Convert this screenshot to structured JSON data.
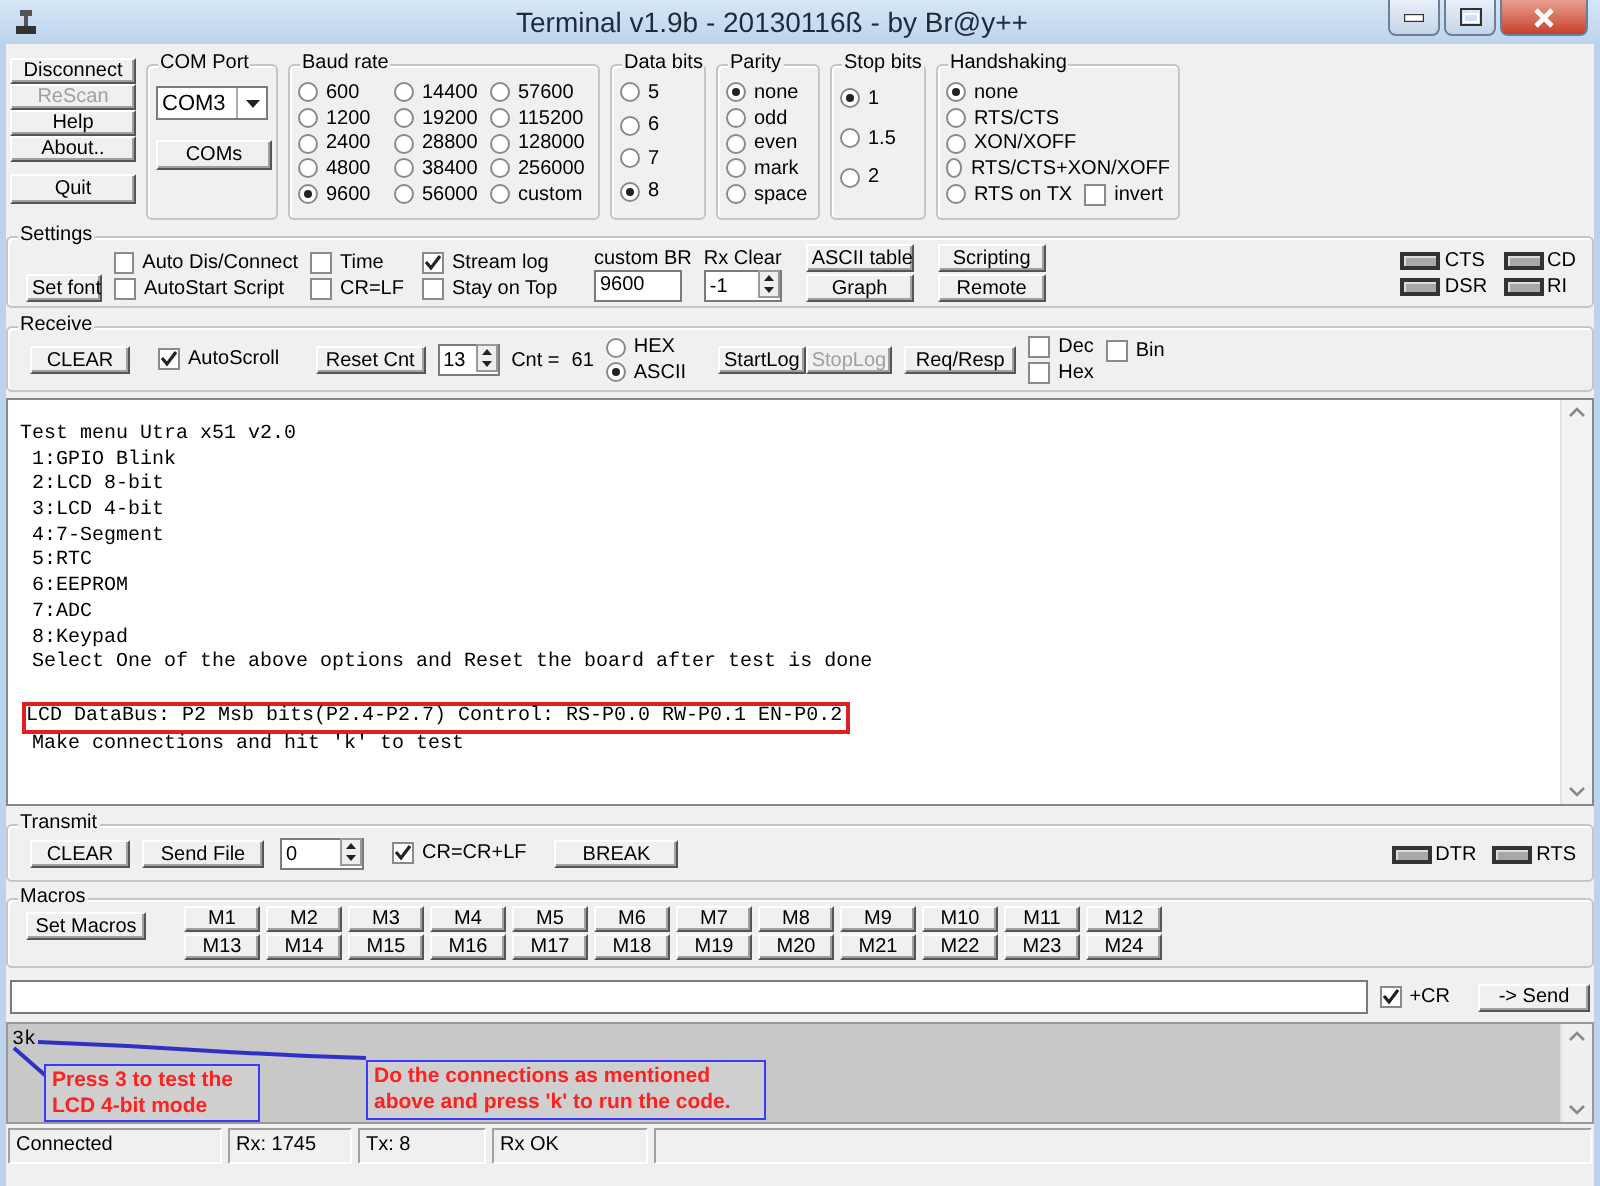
{
  "window": {
    "title": "Terminal v1.9b - 20130116ß - by Br@y++"
  },
  "connection_buttons": [
    {
      "label": "Disconnect",
      "disabled": false
    },
    {
      "label": "ReScan",
      "disabled": true
    },
    {
      "label": "Help",
      "disabled": false
    },
    {
      "label": "About..",
      "disabled": false
    },
    {
      "label": "Quit",
      "disabled": false
    }
  ],
  "com_port": {
    "title": "COM Port",
    "value": "COM3",
    "button": "COMs"
  },
  "baud_rate": {
    "title": "Baud rate",
    "options": [
      {
        "label": "600",
        "selected": false
      },
      {
        "label": "1200",
        "selected": false
      },
      {
        "label": "2400",
        "selected": false
      },
      {
        "label": "4800",
        "selected": false
      },
      {
        "label": "9600",
        "selected": true
      },
      {
        "label": "14400",
        "selected": false
      },
      {
        "label": "19200",
        "selected": false
      },
      {
        "label": "28800",
        "selected": false
      },
      {
        "label": "38400",
        "selected": false
      },
      {
        "label": "56000",
        "selected": false
      },
      {
        "label": "57600",
        "selected": false
      },
      {
        "label": "115200",
        "selected": false
      },
      {
        "label": "128000",
        "selected": false
      },
      {
        "label": "256000",
        "selected": false
      },
      {
        "label": "custom",
        "selected": false
      }
    ]
  },
  "data_bits": {
    "title": "Data bits",
    "options": [
      {
        "label": "5",
        "selected": false
      },
      {
        "label": "6",
        "selected": false
      },
      {
        "label": "7",
        "selected": false
      },
      {
        "label": "8",
        "selected": true
      }
    ]
  },
  "parity": {
    "title": "Parity",
    "options": [
      {
        "label": "none",
        "selected": true
      },
      {
        "label": "odd",
        "selected": false
      },
      {
        "label": "even",
        "selected": false
      },
      {
        "label": "mark",
        "selected": false
      },
      {
        "label": "space",
        "selected": false
      }
    ]
  },
  "stop_bits": {
    "title": "Stop bits",
    "options": [
      {
        "label": "1",
        "selected": true
      },
      {
        "label": "1.5",
        "selected": false
      },
      {
        "label": "2",
        "selected": false
      }
    ]
  },
  "handshaking": {
    "title": "Handshaking",
    "options": [
      {
        "label": "none",
        "selected": true
      },
      {
        "label": "RTS/CTS",
        "selected": false
      },
      {
        "label": "XON/XOFF",
        "selected": false
      },
      {
        "label": "RTS/CTS+XON/XOFF",
        "selected": false
      },
      {
        "label": "RTS on TX",
        "selected": false
      }
    ],
    "invert": {
      "label": "invert",
      "checked": false
    }
  },
  "settings": {
    "title": "Settings",
    "set_font": "Set font",
    "checkboxes": [
      {
        "label": "Auto Dis/Connect",
        "checked": false
      },
      {
        "label": "AutoStart Script",
        "checked": false
      },
      {
        "label": "Time",
        "checked": false
      },
      {
        "label": "CR=LF",
        "checked": false
      },
      {
        "label": "Stream log",
        "checked": true
      },
      {
        "label": "Stay on Top",
        "checked": false
      }
    ],
    "custom_br": {
      "label": "custom BR",
      "value": "9600"
    },
    "rx_clear": {
      "label": "Rx Clear",
      "value": "-1"
    },
    "buttons": [
      "ASCII table",
      "Graph",
      "Scripting",
      "Remote"
    ],
    "indicators": [
      "CTS",
      "CD",
      "DSR",
      "RI"
    ]
  },
  "receive": {
    "title": "Receive",
    "clear": "CLEAR",
    "autoscroll": {
      "label": "AutoScroll",
      "checked": true
    },
    "reset_cnt": "Reset Cnt",
    "spin_value": "13",
    "cnt_label": "Cnt =",
    "cnt_value": "61",
    "modes": [
      {
        "label": "HEX",
        "selected": false
      },
      {
        "label": "ASCII",
        "selected": true
      }
    ],
    "start_log": {
      "label": "StartLog",
      "disabled": false
    },
    "stop_log": {
      "label": "StopLog",
      "disabled": true
    },
    "req_resp": "Req/Resp",
    "formats": [
      {
        "label": "Dec",
        "checked": false
      },
      {
        "label": "Hex",
        "checked": false
      },
      {
        "label": "Bin",
        "checked": false
      }
    ]
  },
  "output": {
    "lines": [
      {
        "text": "Test menu Utra x51 v2.0",
        "highlighted": false
      },
      {
        "text": " 1:GPIO Blink",
        "highlighted": false
      },
      {
        "text": " 2:LCD 8-bit",
        "highlighted": false
      },
      {
        "text": " 3:LCD 4-bit",
        "highlighted": false
      },
      {
        "text": " 4:7-Segment",
        "highlighted": false
      },
      {
        "text": " 5:RTC",
        "highlighted": false
      },
      {
        "text": " 6:EEPROM",
        "highlighted": false
      },
      {
        "text": " 7:ADC",
        "highlighted": false
      },
      {
        "text": " 8:Keypad",
        "highlighted": false
      },
      {
        "text": " Select One of the above options and Reset the board after test is done",
        "highlighted": false
      },
      {
        "text": "LCD DataBus: P2 Msb bits(P2.4-P2.7) Control: RS-P0.0 RW-P0.1 EN-P0.2",
        "highlighted": true
      },
      {
        "text": " Make connections and hit 'k' to test",
        "highlighted": false
      }
    ]
  },
  "transmit": {
    "title": "Transmit",
    "clear": "CLEAR",
    "send_file": "Send File",
    "spin_value": "0",
    "cr_crlf": {
      "label": "CR=CR+LF",
      "checked": true
    },
    "break": "BREAK",
    "indicators": [
      "DTR",
      "RTS"
    ]
  },
  "macros": {
    "title": "Macros",
    "set_macros": "Set Macros",
    "buttons": [
      "M1",
      "M2",
      "M3",
      "M4",
      "M5",
      "M6",
      "M7",
      "M8",
      "M9",
      "M10",
      "M11",
      "M12",
      "M13",
      "M14",
      "M15",
      "M16",
      "M17",
      "M18",
      "M19",
      "M20",
      "M21",
      "M22",
      "M23",
      "M24"
    ]
  },
  "send_bar": {
    "plus_cr": {
      "label": "+CR",
      "checked": true
    },
    "send": "-> Send"
  },
  "transmit_log": {
    "text": "3k",
    "callouts": [
      "Press 3 to test the LCD 4-bit mode",
      "Do the connections as mentioned above and press 'k' to run the code."
    ]
  },
  "status_bar": [
    "Connected",
    "Rx: 1745",
    "Tx: 8",
    "Rx OK"
  ]
}
